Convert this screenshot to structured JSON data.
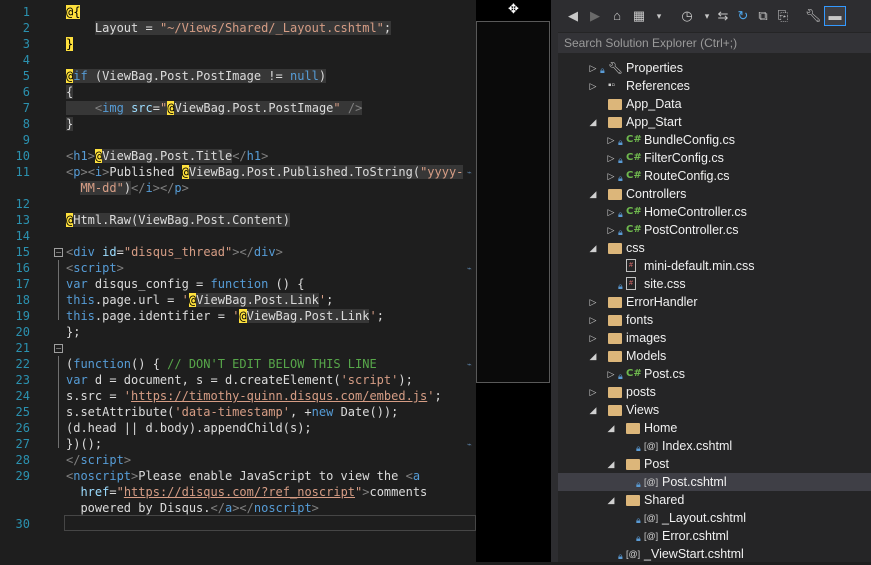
{
  "editor": {
    "lines": [
      {
        "n": "1",
        "html": "<span class=\"raz\">@{</span>"
      },
      {
        "n": "2",
        "html": "    <span class=\"hl\">Layout = <span class=\"str\">\"~/Views/Shared/_Layout.cshtml\"</span>;</span>"
      },
      {
        "n": "3",
        "html": "<span class=\"raz\">}</span>"
      },
      {
        "n": "4",
        "html": ""
      },
      {
        "n": "5",
        "html": "<span class=\"hl\"><span class=\"raz\">@</span><span class=\"kw\">if</span> (ViewBag.Post.PostImage != <span class=\"kw\">null</span>)</span>"
      },
      {
        "n": "6",
        "html": "<span class=\"hl\">{</span>"
      },
      {
        "n": "7",
        "html": "<span class=\"hl\">    <span class=\"tag\">&lt;</span><span class=\"el\">img</span> <span class=\"at\">src</span>=<span class=\"str\">\"</span><span class=\"raz\">@</span>ViewBag.Post.PostImage<span class=\"str\">\"</span> <span class=\"tag\">/&gt;</span></span>"
      },
      {
        "n": "8",
        "html": "<span class=\"hl\">}</span>"
      },
      {
        "n": "9",
        "html": ""
      },
      {
        "n": "10",
        "html": "<span class=\"tag\">&lt;</span><span class=\"el\">h1</span><span class=\"tag\">&gt;</span><span class=\"raz\">@</span><span class=\"hl\">ViewBag.Post.Title</span><span class=\"tag\">&lt;/</span><span class=\"el\">h1</span><span class=\"tag\">&gt;</span>"
      },
      {
        "n": "11",
        "html": "<span class=\"tag\">&lt;</span><span class=\"el\">p</span><span class=\"tag\">&gt;&lt;</span><span class=\"el\">i</span><span class=\"tag\">&gt;</span>Published <span class=\"raz\">@</span><span class=\"hl\">ViewBag.Post.Published.ToString(<span class=\"str\">\"yyyy-</span></span>"
      },
      {
        "n": "",
        "html": "  <span class=\"hl\"><span class=\"str\">MM-dd\"</span>)</span><span class=\"tag\">&lt;/</span><span class=\"el\">i</span><span class=\"tag\">&gt;&lt;/</span><span class=\"el\">p</span><span class=\"tag\">&gt;</span>"
      },
      {
        "n": "12",
        "html": ""
      },
      {
        "n": "13",
        "html": "<span class=\"raz\">@</span><span class=\"hl\">Html.Raw(ViewBag.Post.Content)</span>"
      },
      {
        "n": "14",
        "html": ""
      },
      {
        "n": "15",
        "html": "<span class=\"tag\">&lt;</span><span class=\"el\">div</span> <span class=\"at\">id</span>=<span class=\"str\">\"disqus_thread\"</span><span class=\"tag\">&gt;&lt;/</span><span class=\"el\">div</span><span class=\"tag\">&gt;</span>"
      },
      {
        "n": "16",
        "html": "<span class=\"tag\">&lt;</span><span class=\"el\">script</span><span class=\"tag\">&gt;</span>"
      },
      {
        "n": "17",
        "html": "<span class=\"kw\">var</span> disqus_config = <span class=\"kw\">function</span> () {"
      },
      {
        "n": "18",
        "html": "<span class=\"kw\">this</span>.page.url = <span class=\"str\">'</span><span class=\"raz\">@</span><span class=\"hl\">ViewBag.Post.Link</span><span class=\"str\">'</span>;"
      },
      {
        "n": "19",
        "html": "<span class=\"kw\">this</span>.page.identifier = <span class=\"str\">'</span><span class=\"raz\">@</span><span class=\"hl\">ViewBag.Post.Link</span><span class=\"str\">'</span>;"
      },
      {
        "n": "20",
        "html": "};"
      },
      {
        "n": "21",
        "html": ""
      },
      {
        "n": "22",
        "html": "(<span class=\"kw\">function</span>() { <span class=\"cm\">// DON'T EDIT BELOW THIS LINE</span>"
      },
      {
        "n": "23",
        "html": "<span class=\"kw\">var</span> d = document, s = d.createElement(<span class=\"str\">'script'</span>);"
      },
      {
        "n": "24",
        "html": "s.src = <span class=\"str\">'</span><span class=\"lnk\">https://timothy-quinn.disqus.com/embed.js</span><span class=\"str\">'</span>;"
      },
      {
        "n": "25",
        "html": "s.setAttribute(<span class=\"str\">'data-timestamp'</span>, +<span class=\"kw\">new</span> Date());"
      },
      {
        "n": "26",
        "html": "(d.head || d.body).appendChild(s);"
      },
      {
        "n": "27",
        "html": "})();"
      },
      {
        "n": "28",
        "html": "<span class=\"tag\">&lt;/</span><span class=\"el\">script</span><span class=\"tag\">&gt;</span>"
      },
      {
        "n": "29",
        "html": "<span class=\"tag\">&lt;</span><span class=\"el\">noscript</span><span class=\"tag\">&gt;</span>Please enable JavaScript to view the <span class=\"tag\">&lt;</span><span class=\"el\">a</span>"
      },
      {
        "n": "",
        "html": "  <span class=\"at\">href</span>=<span class=\"str\">\"</span><span class=\"lnk\">https://disqus.com/?ref_noscript</span><span class=\"str\">\"</span><span class=\"tag\">&gt;</span>comments"
      },
      {
        "n": "",
        "html": "  powered by Disqus.<span class=\"tag\">&lt;/</span><span class=\"el\">a</span><span class=\"tag\">&gt;&lt;/</span><span class=\"el\">noscript</span><span class=\"tag\">&gt;</span>"
      },
      {
        "n": "30",
        "html": ""
      }
    ]
  },
  "solution_explorer": {
    "search_placeholder": "Search Solution Explorer (Ctrl+;)",
    "items": [
      {
        "label": "Properties",
        "indent": 0,
        "arrow": "▷",
        "icon": "wrench-icon",
        "lock": true
      },
      {
        "label": "References",
        "indent": 0,
        "arrow": "▷",
        "icon": "references-icon",
        "lock": false
      },
      {
        "label": "App_Data",
        "indent": 0,
        "arrow": "",
        "icon": "folder-icon",
        "lock": false
      },
      {
        "label": "App_Start",
        "indent": 0,
        "arrow": "◢",
        "icon": "folder-icon",
        "lock": false
      },
      {
        "label": "BundleConfig.cs",
        "indent": 1,
        "arrow": "▷",
        "icon": "csharp-icon",
        "lock": true
      },
      {
        "label": "FilterConfig.cs",
        "indent": 1,
        "arrow": "▷",
        "icon": "csharp-icon",
        "lock": true
      },
      {
        "label": "RouteConfig.cs",
        "indent": 1,
        "arrow": "▷",
        "icon": "csharp-icon",
        "lock": true
      },
      {
        "label": "Controllers",
        "indent": 0,
        "arrow": "◢",
        "icon": "folder-icon",
        "lock": false
      },
      {
        "label": "HomeController.cs",
        "indent": 1,
        "arrow": "▷",
        "icon": "csharp-icon",
        "lock": true
      },
      {
        "label": "PostController.cs",
        "indent": 1,
        "arrow": "▷",
        "icon": "csharp-icon",
        "lock": true
      },
      {
        "label": "css",
        "indent": 0,
        "arrow": "◢",
        "icon": "folder-icon",
        "lock": false
      },
      {
        "label": "mini-default.min.css",
        "indent": 1,
        "arrow": "",
        "icon": "css-file-icon",
        "lock": false
      },
      {
        "label": "site.css",
        "indent": 1,
        "arrow": "",
        "icon": "css-file-icon",
        "lock": true
      },
      {
        "label": "ErrorHandler",
        "indent": 0,
        "arrow": "▷",
        "icon": "folder-icon",
        "lock": false
      },
      {
        "label": "fonts",
        "indent": 0,
        "arrow": "▷",
        "icon": "folder-icon",
        "lock": false
      },
      {
        "label": "images",
        "indent": 0,
        "arrow": "▷",
        "icon": "folder-icon",
        "lock": false
      },
      {
        "label": "Models",
        "indent": 0,
        "arrow": "◢",
        "icon": "folder-icon",
        "lock": false
      },
      {
        "label": "Post.cs",
        "indent": 1,
        "arrow": "▷",
        "icon": "csharp-icon",
        "lock": true
      },
      {
        "label": "posts",
        "indent": 0,
        "arrow": "▷",
        "icon": "folder-icon",
        "lock": false
      },
      {
        "label": "Views",
        "indent": 0,
        "arrow": "◢",
        "icon": "folder-icon",
        "lock": false
      },
      {
        "label": "Home",
        "indent": 1,
        "arrow": "◢",
        "icon": "folder-icon",
        "lock": false
      },
      {
        "label": "Index.cshtml",
        "indent": 2,
        "arrow": "",
        "icon": "razor-file-icon",
        "lock": true
      },
      {
        "label": "Post",
        "indent": 1,
        "arrow": "◢",
        "icon": "folder-icon",
        "lock": false
      },
      {
        "label": "Post.cshtml",
        "indent": 2,
        "arrow": "",
        "icon": "razor-file-icon",
        "lock": true,
        "selected": true
      },
      {
        "label": "Shared",
        "indent": 1,
        "arrow": "◢",
        "icon": "folder-icon",
        "lock": false
      },
      {
        "label": "_Layout.cshtml",
        "indent": 2,
        "arrow": "",
        "icon": "razor-file-icon",
        "lock": true
      },
      {
        "label": "Error.cshtml",
        "indent": 2,
        "arrow": "",
        "icon": "razor-file-icon",
        "lock": true
      },
      {
        "label": "_ViewStart.cshtml",
        "indent": 1,
        "arrow": "",
        "icon": "razor-file-icon",
        "lock": true
      }
    ]
  },
  "colors": {
    "selected_bg": "#3f3f46",
    "toolbar_active": "#3e3e42"
  }
}
